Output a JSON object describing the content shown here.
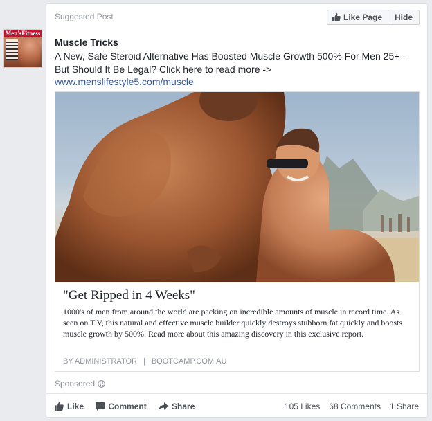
{
  "avatar": {
    "masthead": "Men'sFitness"
  },
  "post": {
    "suggested_label": "Suggested Post",
    "like_page_label": "Like Page",
    "hide_label": "Hide",
    "page_name": "Muscle Tricks",
    "text": "A New, Safe Steroid Alternative Has Boosted Muscle Growth 500% For Men 25+ - But Should It Be Legal? Click here to read more ->",
    "link": "www.menslifestyle5.com/muscle"
  },
  "attachment": {
    "title": "\"Get Ripped in 4 Weeks\"",
    "description": "1000's of men from around the world are packing on incredible amounts of muscle in record time. As seen on T.V, this natural and effective muscle builder quickly destroys stubborn fat quickly and boosts muscle growth by 500%. Read more about this amazing discovery in this exclusive report.",
    "author": "BY ADMINISTRATOR",
    "domain": "BOOTCAMP.COM.AU"
  },
  "footer": {
    "sponsored_label": "Sponsored",
    "like_label": "Like",
    "comment_label": "Comment",
    "share_label": "Share",
    "likes_count": "105 Likes",
    "comments_count": "68 Comments",
    "shares_count": "1 Share"
  },
  "icons": {
    "thumbs_up": "thumbs-up-icon",
    "comment": "comment-icon",
    "share": "share-arrow-icon",
    "globe": "globe-icon"
  },
  "colors": {
    "link": "#365899",
    "meta": "#90949c",
    "text": "#1d2129"
  }
}
